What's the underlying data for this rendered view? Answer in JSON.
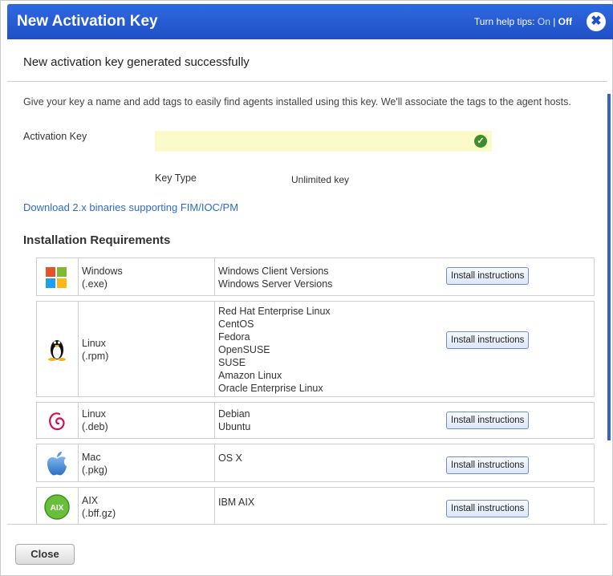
{
  "dialog": {
    "title": "New Activation Key",
    "help_tips_prefix": "Turn help tips: ",
    "help_tips_on": "On",
    "help_tips_sep": " | ",
    "help_tips_off": "Off",
    "close_glyph": "✖"
  },
  "content": {
    "success_message": "New activation key generated successfully",
    "intro": "Give your key a name and add tags to easily find agents installed using this key. We'll associate the tags to the agent hosts.",
    "activation_key_label": "Activation Key",
    "activation_key_value": "",
    "key_type_label": "Key Type",
    "key_type_value": "Unlimited key",
    "download_link": "Download 2.x binaries supporting FIM/IOC/PM",
    "requirements_title": "Installation Requirements"
  },
  "requirements": [
    {
      "os": "Windows",
      "pkg": "(.exe)",
      "versions": [
        "Windows Client Versions",
        "Windows Server Versions"
      ],
      "button": "Install instructions",
      "icon": "windows-icon"
    },
    {
      "os": "Linux",
      "pkg": "(.rpm)",
      "versions": [
        "Red Hat Enterprise Linux",
        "CentOS",
        "Fedora",
        "OpenSUSE",
        "SUSE",
        "Amazon Linux",
        "Oracle Enterprise Linux"
      ],
      "button": "Install instructions",
      "icon": "linux-tux-icon"
    },
    {
      "os": "Linux",
      "pkg": "(.deb)",
      "versions": [
        "Debian",
        "Ubuntu"
      ],
      "button": "Install instructions",
      "icon": "debian-icon"
    },
    {
      "os": "Mac",
      "pkg": "(.pkg)",
      "versions": [
        "OS X"
      ],
      "button": "Install instructions",
      "icon": "apple-icon"
    },
    {
      "os": "AIX",
      "pkg": "(.bff.gz)",
      "versions": [
        "IBM AIX"
      ],
      "button": "Install instructions",
      "icon": "aix-icon",
      "icon_text": "AIX"
    }
  ],
  "footer": {
    "close_label": "Close"
  },
  "colors": {
    "title_bar": "#1f4fc6",
    "link": "#2f6bcc",
    "key_field": "#fbfbc9",
    "check": "#3e8e2c"
  }
}
